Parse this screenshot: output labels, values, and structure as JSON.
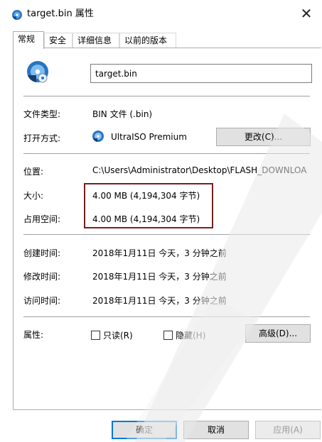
{
  "window": {
    "title": "target.bin 属性",
    "close_glyph": "✕"
  },
  "tabs": [
    {
      "label": "常规",
      "active": true
    },
    {
      "label": "安全",
      "active": false
    },
    {
      "label": "详细信息",
      "active": false
    },
    {
      "label": "以前的版本",
      "active": false
    }
  ],
  "file": {
    "name": "target.bin"
  },
  "general": {
    "type_label": "文件类型:",
    "type_value": "BIN 文件 (.bin)",
    "open_with_label": "打开方式:",
    "open_with_value": "UltraISO Premium",
    "change_button": "更改(C)...",
    "location_label": "位置:",
    "location_value": "C:\\Users\\Administrator\\Desktop\\FLASH_DOWNLOA",
    "size_label": "大小:",
    "size_value": "4.00 MB (4,194,304 字节)",
    "disk_size_label": "占用空间:",
    "disk_size_value": "4.00 MB (4,194,304 字节)",
    "created_label": "创建时间:",
    "created_value": "2018年1月11日 今天，3 分钟之前",
    "modified_label": "修改时间:",
    "modified_value": "2018年1月11日 今天，3 分钟之前",
    "accessed_label": "访问时间:",
    "accessed_value": "2018年1月11日 今天，3 分钟之前",
    "attributes_label": "属性:",
    "readonly_label": "只读(R)",
    "hidden_label": "隐藏(H)",
    "advanced_button": "高级(D)..."
  },
  "footer": {
    "ok": "确定",
    "cancel": "取消",
    "apply": "应用(A)"
  },
  "icons": {
    "title": "disc-app-icon",
    "file": "disc-file-icon",
    "open_with": "ultraiso-icon"
  },
  "colors": {
    "highlight_box": "#7a1e1e",
    "primary_border": "#0078d7"
  }
}
